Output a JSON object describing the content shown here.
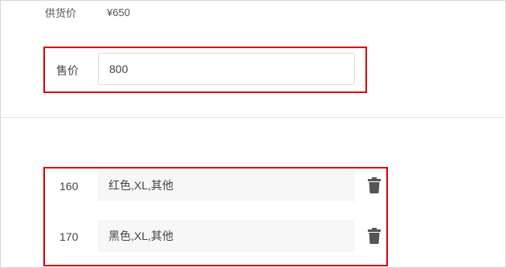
{
  "supply": {
    "label": "供货价",
    "value": "¥650"
  },
  "sale": {
    "label": "售价",
    "value": "800"
  },
  "specs": [
    {
      "number": "160",
      "text": "红色,XL,其他",
      "icon": "trash-icon"
    },
    {
      "number": "170",
      "text": "黑色,XL,其他",
      "icon": "trash-icon"
    }
  ],
  "colors": {
    "highlight": "#e00000",
    "icon": "#555555",
    "field_bg": "#f7f7f7"
  }
}
